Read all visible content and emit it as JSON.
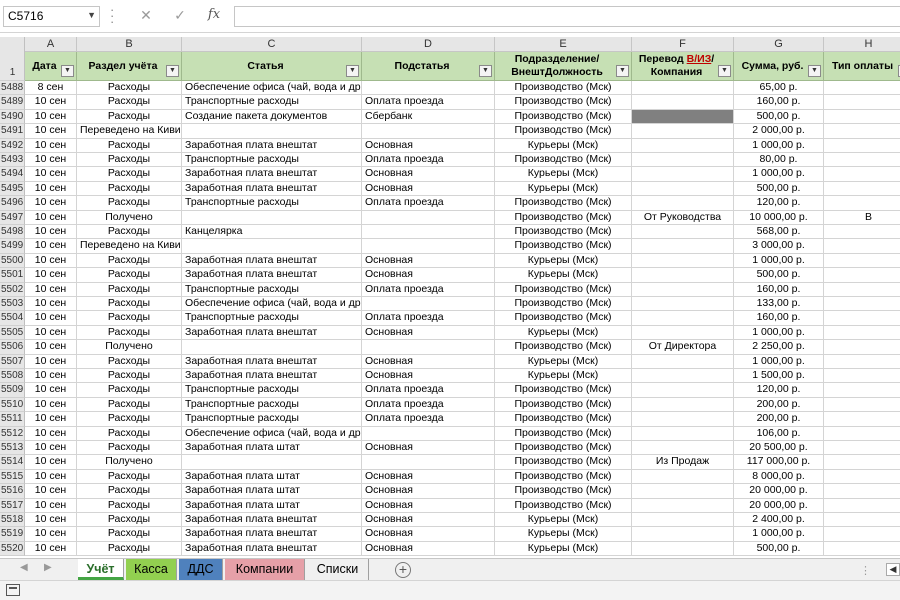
{
  "formula_bar": {
    "name_box": "C5716",
    "cancel_icon": "✕",
    "enter_icon": "✓",
    "fx_label": "fx",
    "formula_value": ""
  },
  "columns": [
    {
      "letter": "A",
      "header": "Дата"
    },
    {
      "letter": "B",
      "header": "Раздел учёта"
    },
    {
      "letter": "C",
      "header": "Статья"
    },
    {
      "letter": "D",
      "header": "Подстатья"
    },
    {
      "letter": "E",
      "header": "Подразделение/ ВнештДолжность"
    },
    {
      "letter": "F",
      "header_pre": "Перевод ",
      "header_red": "В/ИЗ",
      "header_post": "/ Компания"
    },
    {
      "letter": "G",
      "header": "Сумма, руб."
    },
    {
      "letter": "H",
      "header": "Тип оплаты"
    }
  ],
  "header_row_number": "1",
  "rows": [
    {
      "n": "5488",
      "a": "8 сен",
      "b": "Расходы",
      "c": "Обеспечение офиса (чай, вода и др.)",
      "d": "",
      "e": "Производство (Мск)",
      "f": "",
      "g": "65,00 р.",
      "h": ""
    },
    {
      "n": "5489",
      "a": "10 сен",
      "b": "Расходы",
      "c": "Транспортные расходы",
      "d": "Оплата проезда",
      "e": "Производство (Мск)",
      "f": "",
      "g": "160,00 р.",
      "h": ""
    },
    {
      "n": "5490",
      "a": "10 сен",
      "b": "Расходы",
      "c": "Создание пакета документов",
      "d": "Сбербанк",
      "e": "Производство (Мск)",
      "f": "",
      "g": "500,00 р.",
      "h": "",
      "f_dark": true
    },
    {
      "n": "5491",
      "a": "10 сен",
      "b": "Переведено на Киви",
      "c": "",
      "d": "",
      "e": "Производство (Мск)",
      "f": "",
      "g": "2 000,00 р.",
      "h": ""
    },
    {
      "n": "5492",
      "a": "10 сен",
      "b": "Расходы",
      "c": "Заработная плата внештат",
      "d": "Основная",
      "e": "Курьеры (Мск)",
      "f": "",
      "g": "1 000,00 р.",
      "h": ""
    },
    {
      "n": "5493",
      "a": "10 сен",
      "b": "Расходы",
      "c": "Транспортные расходы",
      "d": "Оплата проезда",
      "e": "Производство (Мск)",
      "f": "",
      "g": "80,00 р.",
      "h": ""
    },
    {
      "n": "5494",
      "a": "10 сен",
      "b": "Расходы",
      "c": "Заработная плата внештат",
      "d": "Основная",
      "e": "Курьеры (Мск)",
      "f": "",
      "g": "1 000,00 р.",
      "h": ""
    },
    {
      "n": "5495",
      "a": "10 сен",
      "b": "Расходы",
      "c": "Заработная плата внештат",
      "d": "Основная",
      "e": "Курьеры (Мск)",
      "f": "",
      "g": "500,00 р.",
      "h": ""
    },
    {
      "n": "5496",
      "a": "10 сен",
      "b": "Расходы",
      "c": "Транспортные расходы",
      "d": "Оплата проезда",
      "e": "Производство (Мск)",
      "f": "",
      "g": "120,00 р.",
      "h": ""
    },
    {
      "n": "5497",
      "a": "10 сен",
      "b": "Получено",
      "c": "",
      "d": "",
      "e": "Производство (Мск)",
      "f": "От Руководства",
      "g": "10 000,00 р.",
      "h": "В"
    },
    {
      "n": "5498",
      "a": "10 сен",
      "b": "Расходы",
      "c": "Канцелярка",
      "d": "",
      "e": "Производство (Мск)",
      "f": "",
      "g": "568,00 р.",
      "h": ""
    },
    {
      "n": "5499",
      "a": "10 сен",
      "b": "Переведено на Киви",
      "c": "",
      "d": "",
      "e": "Производство (Мск)",
      "f": "",
      "g": "3 000,00 р.",
      "h": ""
    },
    {
      "n": "5500",
      "a": "10 сен",
      "b": "Расходы",
      "c": "Заработная плата внештат",
      "d": "Основная",
      "e": "Курьеры (Мск)",
      "f": "",
      "g": "1 000,00 р.",
      "h": ""
    },
    {
      "n": "5501",
      "a": "10 сен",
      "b": "Расходы",
      "c": "Заработная плата внештат",
      "d": "Основная",
      "e": "Курьеры (Мск)",
      "f": "",
      "g": "500,00 р.",
      "h": ""
    },
    {
      "n": "5502",
      "a": "10 сен",
      "b": "Расходы",
      "c": "Транспортные расходы",
      "d": "Оплата проезда",
      "e": "Производство (Мск)",
      "f": "",
      "g": "160,00 р.",
      "h": ""
    },
    {
      "n": "5503",
      "a": "10 сен",
      "b": "Расходы",
      "c": "Обеспечение офиса (чай, вода и др.)",
      "d": "",
      "e": "Производство (Мск)",
      "f": "",
      "g": "133,00 р.",
      "h": ""
    },
    {
      "n": "5504",
      "a": "10 сен",
      "b": "Расходы",
      "c": "Транспортные расходы",
      "d": "Оплата проезда",
      "e": "Производство (Мск)",
      "f": "",
      "g": "160,00 р.",
      "h": ""
    },
    {
      "n": "5505",
      "a": "10 сен",
      "b": "Расходы",
      "c": "Заработная плата внештат",
      "d": "Основная",
      "e": "Курьеры (Мск)",
      "f": "",
      "g": "1 000,00 р.",
      "h": ""
    },
    {
      "n": "5506",
      "a": "10 сен",
      "b": "Получено",
      "c": "",
      "d": "",
      "e": "Производство (Мск)",
      "f": "От Директора",
      "g": "2 250,00 р.",
      "h": ""
    },
    {
      "n": "5507",
      "a": "10 сен",
      "b": "Расходы",
      "c": "Заработная плата внештат",
      "d": "Основная",
      "e": "Курьеры (Мск)",
      "f": "",
      "g": "1 000,00 р.",
      "h": ""
    },
    {
      "n": "5508",
      "a": "10 сен",
      "b": "Расходы",
      "c": "Заработная плата внештат",
      "d": "Основная",
      "e": "Курьеры (Мск)",
      "f": "",
      "g": "1 500,00 р.",
      "h": ""
    },
    {
      "n": "5509",
      "a": "10 сен",
      "b": "Расходы",
      "c": "Транспортные расходы",
      "d": "Оплата проезда",
      "e": "Производство (Мск)",
      "f": "",
      "g": "120,00 р.",
      "h": ""
    },
    {
      "n": "5510",
      "a": "10 сен",
      "b": "Расходы",
      "c": "Транспортные расходы",
      "d": "Оплата проезда",
      "e": "Производство (Мск)",
      "f": "",
      "g": "200,00 р.",
      "h": ""
    },
    {
      "n": "5511",
      "a": "10 сен",
      "b": "Расходы",
      "c": "Транспортные расходы",
      "d": "Оплата проезда",
      "e": "Производство (Мск)",
      "f": "",
      "g": "200,00 р.",
      "h": ""
    },
    {
      "n": "5512",
      "a": "10 сен",
      "b": "Расходы",
      "c": "Обеспечение офиса (чай, вода и др.)",
      "d": "",
      "e": "Производство (Мск)",
      "f": "",
      "g": "106,00 р.",
      "h": ""
    },
    {
      "n": "5513",
      "a": "10 сен",
      "b": "Расходы",
      "c": "Заработная плата штат",
      "d": "Основная",
      "e": "Производство (Мск)",
      "f": "",
      "g": "20 500,00 р.",
      "h": ""
    },
    {
      "n": "5514",
      "a": "10 сен",
      "b": "Получено",
      "c": "",
      "d": "",
      "e": "Производство (Мск)",
      "f": "Из Продаж",
      "g": "117 000,00 р.",
      "h": ""
    },
    {
      "n": "5515",
      "a": "10 сен",
      "b": "Расходы",
      "c": "Заработная плата штат",
      "d": "Основная",
      "e": "Производство (Мск)",
      "f": "",
      "g": "8 000,00 р.",
      "h": ""
    },
    {
      "n": "5516",
      "a": "10 сен",
      "b": "Расходы",
      "c": "Заработная плата штат",
      "d": "Основная",
      "e": "Производство (Мск)",
      "f": "",
      "g": "20 000,00 р.",
      "h": ""
    },
    {
      "n": "5517",
      "a": "10 сен",
      "b": "Расходы",
      "c": "Заработная плата штат",
      "d": "Основная",
      "e": "Производство (Мск)",
      "f": "",
      "g": "20 000,00 р.",
      "h": ""
    },
    {
      "n": "5518",
      "a": "10 сен",
      "b": "Расходы",
      "c": "Заработная плата внештат",
      "d": "Основная",
      "e": "Курьеры (Мск)",
      "f": "",
      "g": "2 400,00 р.",
      "h": ""
    },
    {
      "n": "5519",
      "a": "10 сен",
      "b": "Расходы",
      "c": "Заработная плата внештат",
      "d": "Основная",
      "e": "Курьеры (Мск)",
      "f": "",
      "g": "1 000,00 р.",
      "h": ""
    },
    {
      "n": "5520",
      "a": "10 сен",
      "b": "Расходы",
      "c": "Заработная плата внештат",
      "d": "Основная",
      "e": "Курьеры (Мск)",
      "f": "",
      "g": "500,00 р.",
      "h": ""
    }
  ],
  "sheet_tabs": [
    {
      "label": "Учёт",
      "color": "#92d050",
      "active": true
    },
    {
      "label": "Касса",
      "color": "#92d050",
      "active": false
    },
    {
      "label": "ДДС",
      "color": "#4f81bd",
      "active": false
    },
    {
      "label": "Компании",
      "color": "#e6a0a8",
      "active": false
    },
    {
      "label": "Списки",
      "color": "",
      "active": false
    }
  ],
  "colors": {
    "header_fill": "#c6e0b4",
    "dark_cell": "#808080",
    "accent_red": "#c00000"
  }
}
